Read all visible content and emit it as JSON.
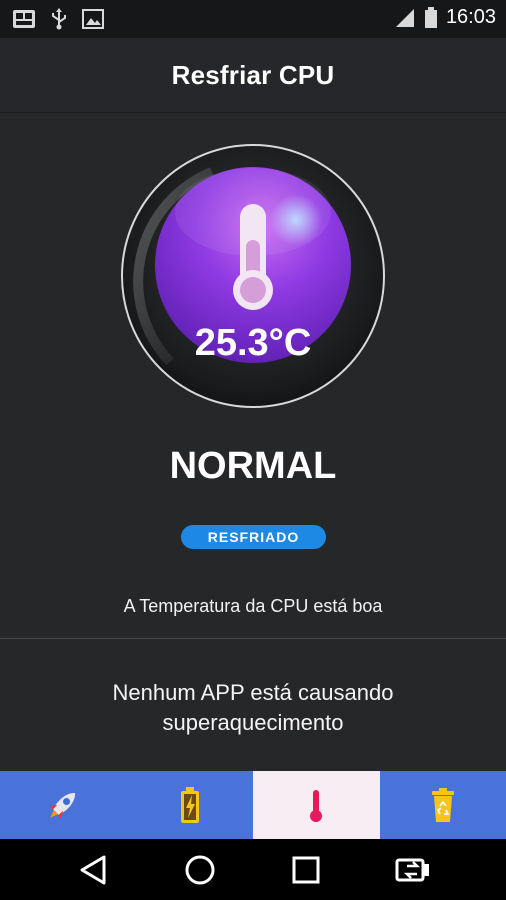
{
  "statusbar": {
    "time": "16:03",
    "left_icons": [
      "sim-icon",
      "usb-icon",
      "image-icon"
    ],
    "right_icons": [
      "signal-icon",
      "battery-icon"
    ]
  },
  "appbar": {
    "title": "Resfriar CPU"
  },
  "gauge": {
    "temperature": "25.3°C",
    "colors": {
      "inner": "#8e3be0",
      "ring": "#d9d9d9"
    }
  },
  "status": {
    "label": "NORMAL",
    "badge": "RESFRIADO",
    "badge_color": "#1e88e5",
    "info": "A Temperatura da CPU está boa"
  },
  "message": "Nenhum APP está causando superaquecimento",
  "tabs": [
    {
      "icon": "rocket-icon",
      "active": false
    },
    {
      "icon": "battery-charging-icon",
      "active": false
    },
    {
      "icon": "thermometer-icon",
      "active": true
    },
    {
      "icon": "trash-recycle-icon",
      "active": false
    }
  ],
  "navbar": [
    "back-icon",
    "home-icon",
    "recents-icon",
    "switch-icon"
  ]
}
